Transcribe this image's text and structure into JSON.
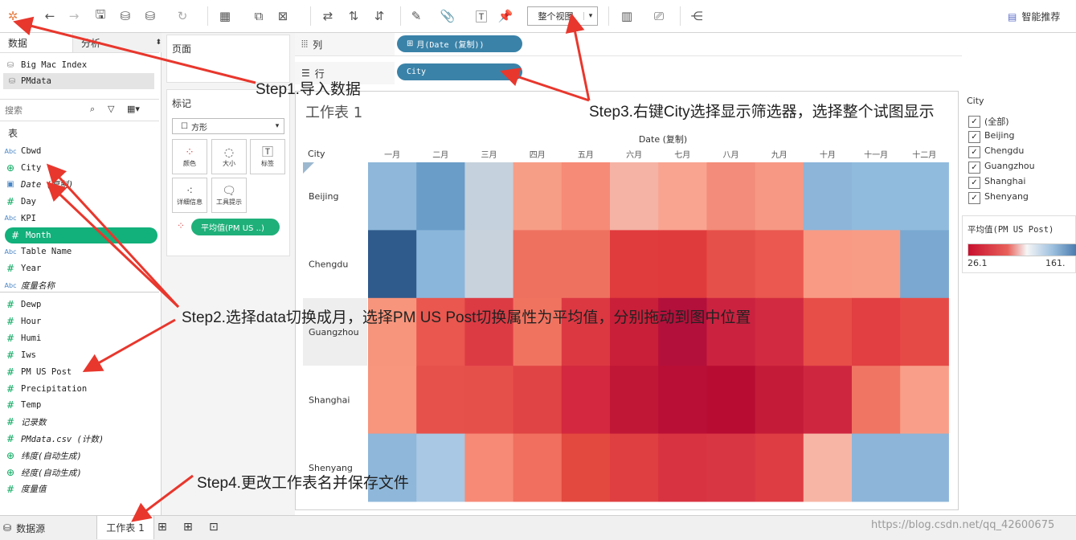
{
  "toolbar": {
    "fit_label": "整个视图",
    "smart_label": "智能推荐"
  },
  "left": {
    "tab_data": "数据",
    "tab_analysis": "分析",
    "sources": [
      "Big Mac Index",
      "PMdata"
    ],
    "search_placeholder": "搜索",
    "table_label": "表",
    "dimensions": [
      {
        "icon": "Abc",
        "name": "Cbwd"
      },
      {
        "icon": "globe",
        "name": "City"
      },
      {
        "icon": "cal",
        "name": "Date (复制)"
      },
      {
        "icon": "#",
        "name": "Day"
      },
      {
        "icon": "Abc",
        "name": "KPI"
      },
      {
        "icon": "#",
        "name": "Month",
        "selected": true
      },
      {
        "icon": "Abc",
        "name": "Table Name"
      },
      {
        "icon": "#",
        "name": "Year"
      },
      {
        "icon": "Abc",
        "name": "度量名称"
      }
    ],
    "measures": [
      {
        "icon": "#",
        "name": "Dewp"
      },
      {
        "icon": "#",
        "name": "Hour"
      },
      {
        "icon": "#",
        "name": "Humi"
      },
      {
        "icon": "#",
        "name": "Iws"
      },
      {
        "icon": "#",
        "name": "PM US Post"
      },
      {
        "icon": "#",
        "name": "Precipitation"
      },
      {
        "icon": "#",
        "name": "Temp"
      },
      {
        "icon": "#",
        "name": "记录数"
      },
      {
        "icon": "#",
        "name": "PMdata.csv (计数)"
      },
      {
        "icon": "globe",
        "name": "纬度(自动生成)"
      },
      {
        "icon": "globe",
        "name": "经度(自动生成)"
      },
      {
        "icon": "#",
        "name": "度量值"
      }
    ]
  },
  "middle": {
    "pages_label": "页面",
    "marks_label": "标记",
    "mark_type": "方形",
    "buttons": [
      "颜色",
      "大小",
      "标签",
      "详细信息",
      "工具提示"
    ],
    "measure_pill": "平均值(PM US ..)"
  },
  "shelves": {
    "col_label": "列",
    "row_label": "行",
    "col_pill": "月(Date (复制))",
    "row_pill": "City"
  },
  "view": {
    "title": "工作表 1",
    "col_header": "Date (复制)",
    "city_header": "City"
  },
  "chart_data": {
    "type": "heatmap",
    "title": "工作表 1",
    "xlabel": "Date (复制)",
    "ylabel": "City",
    "x": [
      "一月",
      "二月",
      "三月",
      "四月",
      "五月",
      "六月",
      "七月",
      "八月",
      "九月",
      "十月",
      "十一月",
      "十二月"
    ],
    "y": [
      "Beijing",
      "Chengdu",
      "Guangzhou",
      "Shanghai",
      "Shenyang"
    ],
    "colors": [
      [
        "#8eb7da",
        "#6a9dc8",
        "#c5d1dc",
        "#f79e86",
        "#f68b77",
        "#f5b3a5",
        "#f9a491",
        "#f38c7a",
        "#f69884",
        "#8cb5d9",
        "#91bbdc",
        "#91bbdc"
      ],
      [
        "#2f5a8c",
        "#8ab6db",
        "#c8d2dd",
        "#ee715f",
        "#ee715f",
        "#e03b3d",
        "#df3b3d",
        "#e6504a",
        "#ea584f",
        "#f99b84",
        "#f99c86",
        "#7aa8d0"
      ],
      [
        "#f7957c",
        "#e9574f",
        "#dc3b44",
        "#f07360",
        "#dc3842",
        "#c91f39",
        "#b3103b",
        "#cb2240",
        "#d22a40",
        "#e74e47",
        "#e13f42",
        "#e64a47"
      ],
      [
        "#f7957d",
        "#e6514b",
        "#e6504b",
        "#e04444",
        "#d3283f",
        "#c01737",
        "#b90f37",
        "#b80c33",
        "#c41b39",
        "#cf2640",
        "#f07663",
        "#f99f89"
      ],
      [
        "#8eb7da",
        "#a8c8e3",
        "#f78a76",
        "#f06f5f",
        "#e3493f",
        "#df3f41",
        "#d83341",
        "#d93644",
        "#de3d43",
        "#f7b6a5",
        "#8cb5d9",
        "#8cb5d9"
      ]
    ]
  },
  "filter": {
    "title": "City",
    "items": [
      "(全部)",
      "Beijing",
      "Chengdu",
      "Guangzhou",
      "Shanghai",
      "Shenyang"
    ]
  },
  "legend": {
    "title": "平均值(PM US Post)",
    "min": "26.1",
    "max": "161.",
    "min_color": "#c8102e",
    "max_color": "#3a6da4"
  },
  "bottom": {
    "datasource": "数据源",
    "sheet": "工作表 1",
    "watermark": "https://blog.csdn.net/qq_42600675"
  },
  "annotations": {
    "step1": "Step1.导入数据",
    "step2": "Step2.选择data切换成月，选择PM US Post切换属性为平均值，分别拖动到图中位置",
    "step3": "Step3.右键City选择显示筛选器，选择整个试图显示",
    "step4": "Step4.更改工作表名并保存文件"
  }
}
